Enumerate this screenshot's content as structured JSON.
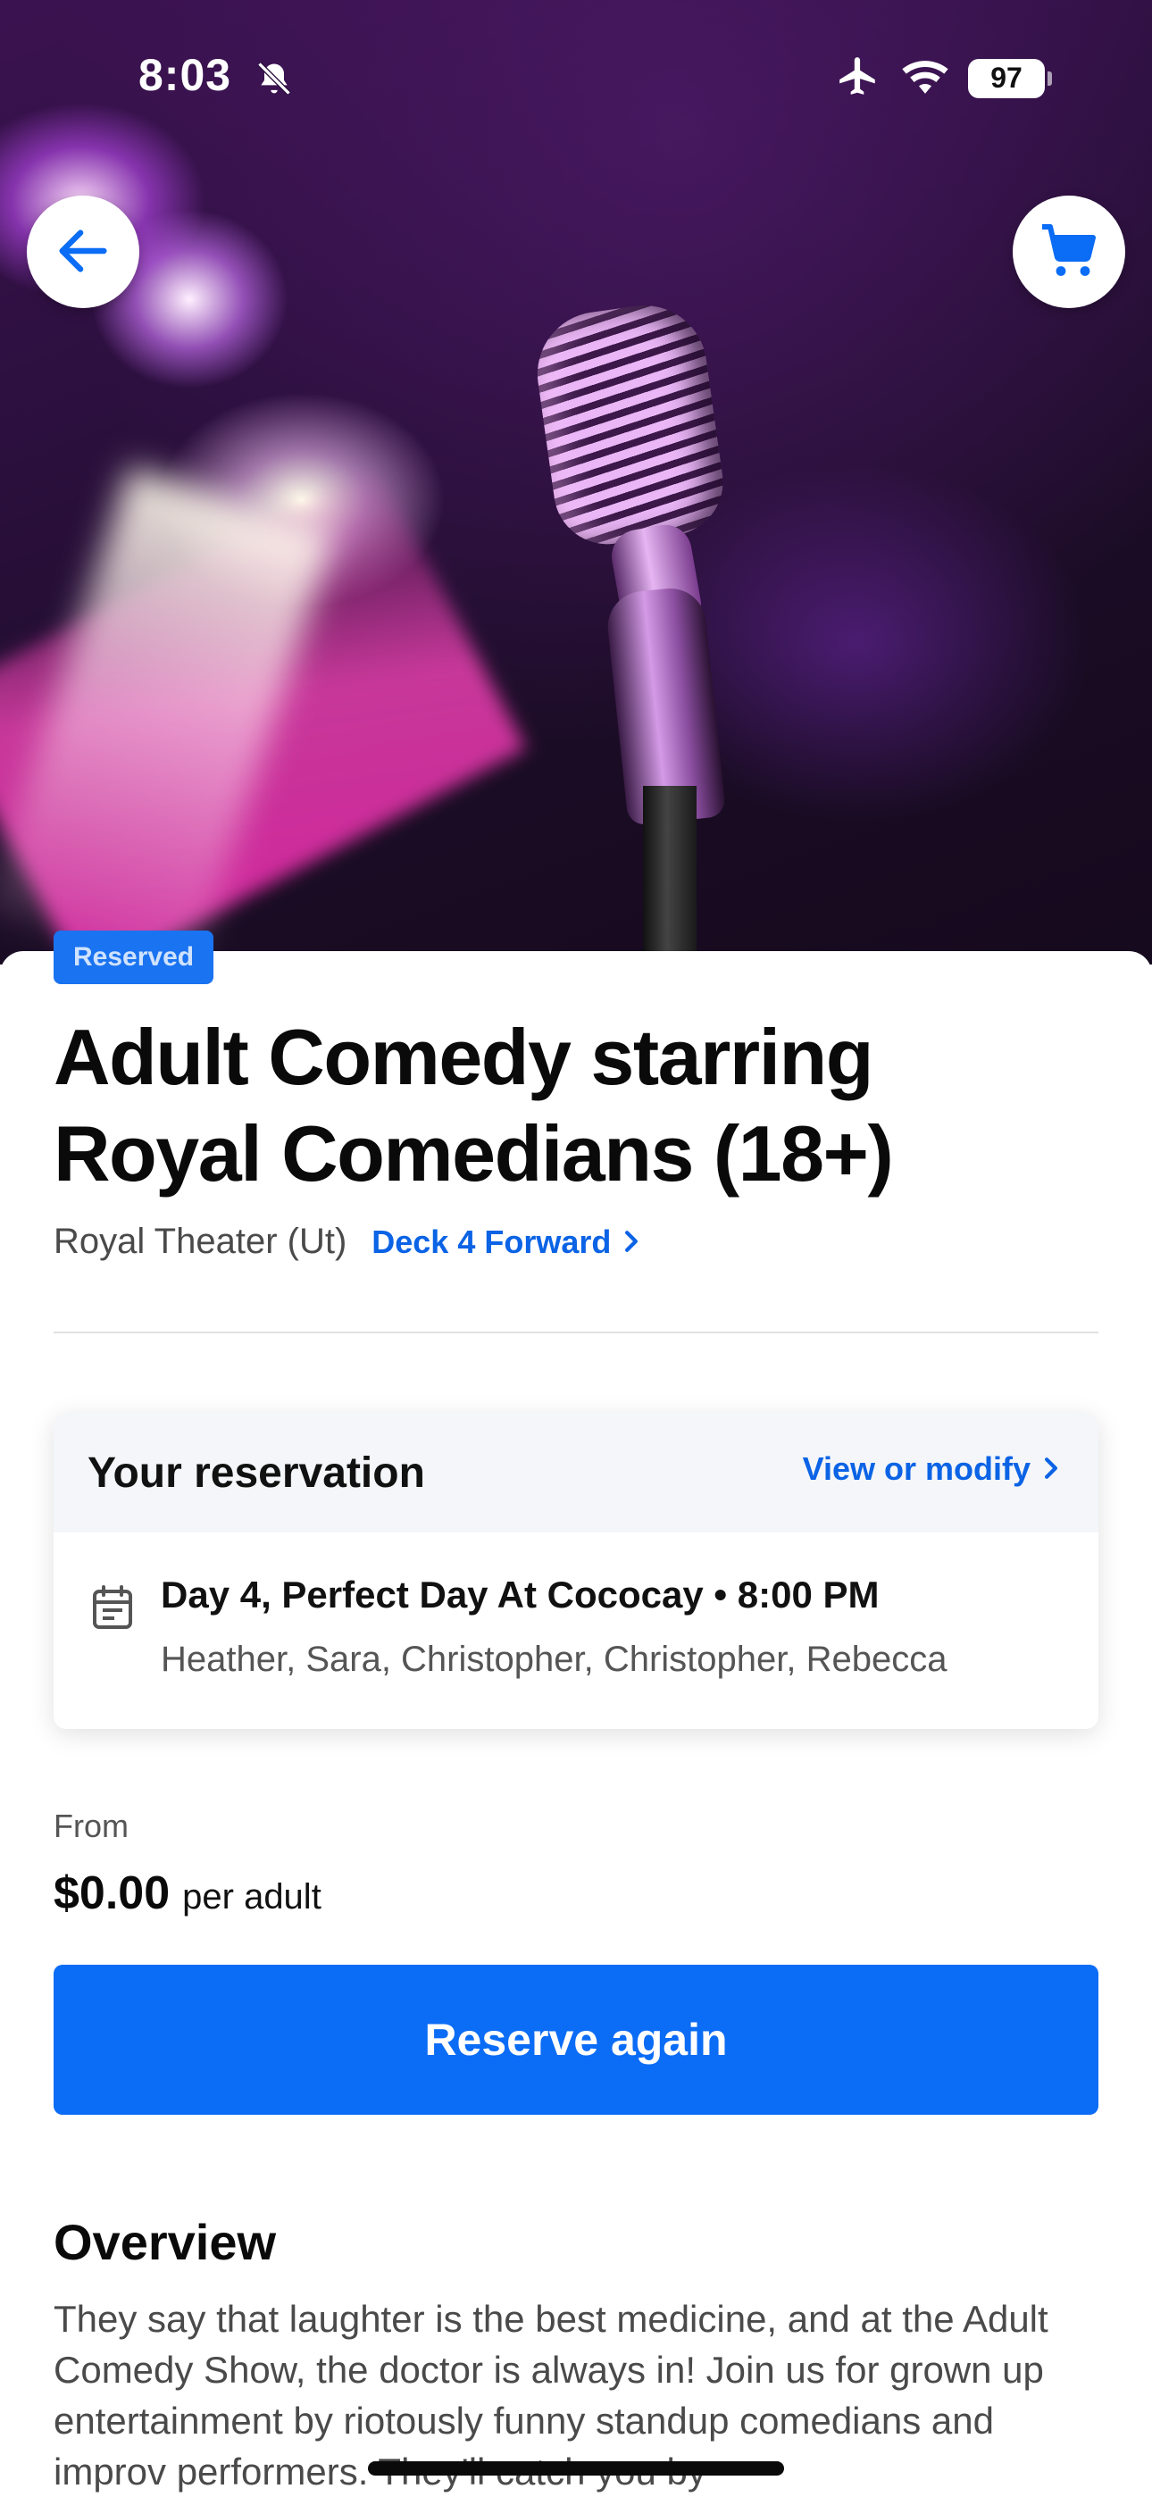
{
  "status_bar": {
    "time": "8:03",
    "battery": "97",
    "icons": [
      "bell-slash-icon",
      "airplane-icon",
      "wifi-icon",
      "battery-icon"
    ]
  },
  "nav": {
    "back_icon": "arrow-left-icon",
    "cart_icon": "cart-icon",
    "accent": "#0B6CF5"
  },
  "event": {
    "badge": "Reserved",
    "title": "Adult Comedy starring Royal Comedians (18+)",
    "venue": "Royal Theater (Ut)",
    "deck_link": "Deck 4 Forward"
  },
  "reservation": {
    "header": "Your reservation",
    "modify_link": "View or modify",
    "day_line": "Day 4, Perfect Day At Cococay • 8:00 PM",
    "guests": "Heather, Sara, Christopher, Christopher, Rebecca",
    "icon": "calendar-icon"
  },
  "pricing": {
    "from_label": "From",
    "price": "$0.00",
    "unit": "per adult"
  },
  "actions": {
    "reserve_label": "Reserve again"
  },
  "overview": {
    "heading": "Overview",
    "text": "They say that laughter is the best medicine, and at the Adult Comedy Show, the doctor is always in! Join us for grown up entertainment by riotously funny standup comedians and improv performers. They'll catch you by"
  }
}
